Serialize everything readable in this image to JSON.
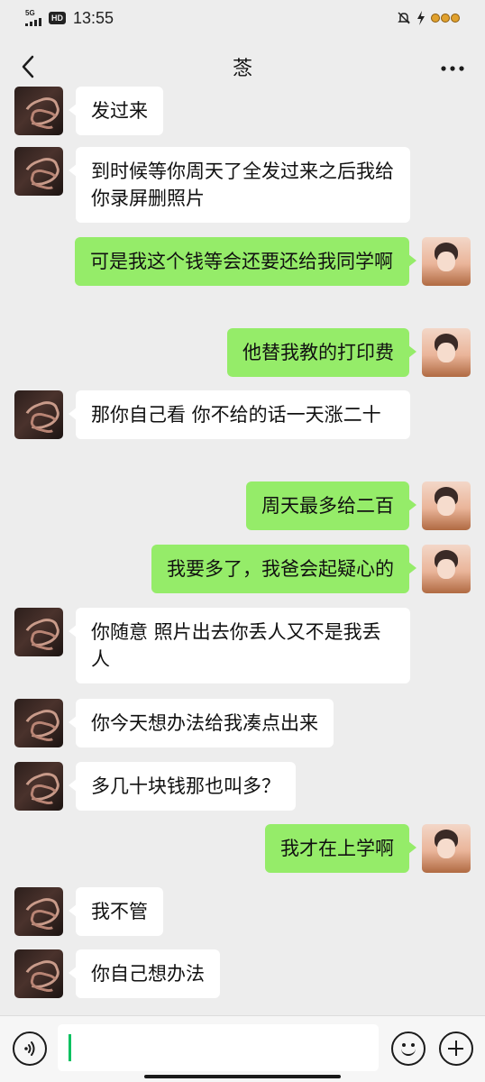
{
  "status_bar": {
    "network": "5G",
    "hd": "HD",
    "time": "13:55"
  },
  "header": {
    "title": "菍",
    "back_icon": "chevron-left-icon",
    "more_icon": "ellipsis-icon"
  },
  "colors": {
    "background": "#ededed",
    "incoming_bubble": "#ffffff",
    "outgoing_bubble": "#95ec69",
    "cursor": "#07c160"
  },
  "messages": [
    {
      "side": "in",
      "text": "发过来"
    },
    {
      "side": "in",
      "text": "到时候等你周天了全发过来之后我给你录屏删照片"
    },
    {
      "side": "out",
      "text": "可是我这个钱等会还要还给我同学啊"
    },
    {
      "side": "out",
      "text": "他替我教的打印费"
    },
    {
      "side": "in",
      "text": "那你自己看  你不给的话一天涨二十"
    },
    {
      "side": "out",
      "text": "周天最多给二百"
    },
    {
      "side": "out",
      "text": "我要多了，我爸会起疑心的"
    },
    {
      "side": "in",
      "text": "你随意  照片出去你丢人又不是我丢人"
    },
    {
      "side": "in",
      "text": "你今天想办法给我凑点出来"
    },
    {
      "side": "in",
      "text": "多几十块钱那也叫多？"
    },
    {
      "side": "out",
      "text": "我才在上学啊"
    },
    {
      "side": "in",
      "text": "我不管"
    },
    {
      "side": "in",
      "text": "你自己想办法"
    }
  ],
  "input_bar": {
    "voice_icon": "voice-icon",
    "text_value": "",
    "emoji_icon": "emoji-icon",
    "plus_icon": "plus-icon"
  }
}
